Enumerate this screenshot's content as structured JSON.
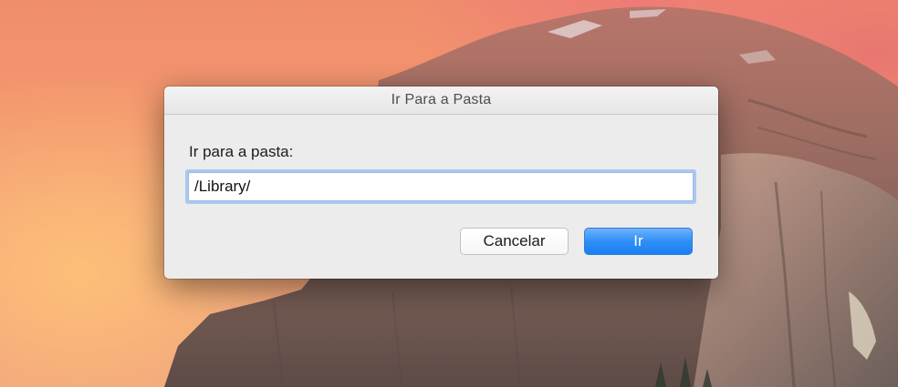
{
  "dialog": {
    "title": "Ir Para a Pasta",
    "prompt_label": "Ir para a pasta:",
    "path_value": "/Library/",
    "cancel_label": "Cancelar",
    "go_label": "Ir"
  },
  "colors": {
    "accent": "#1a7ff2",
    "focus_ring": "#a9c8f3",
    "dialog_bg": "#ececec"
  }
}
